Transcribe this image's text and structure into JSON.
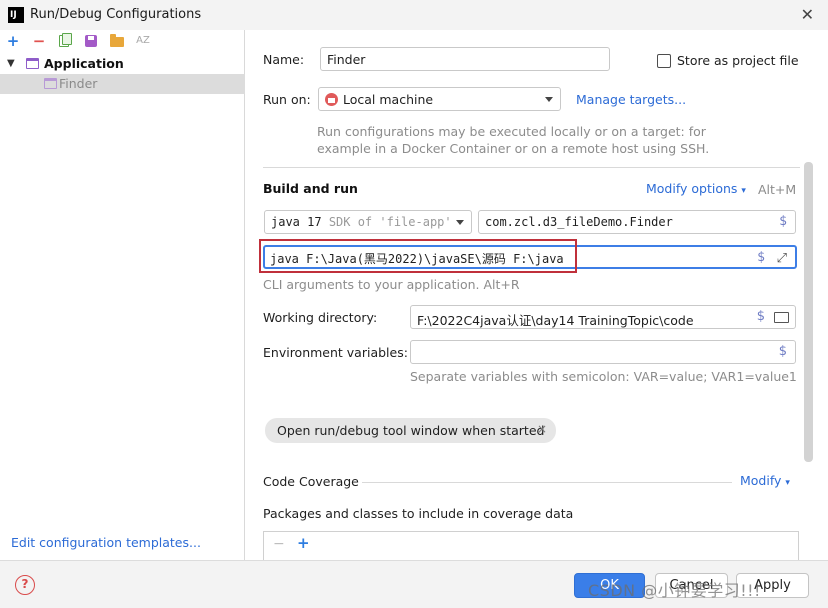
{
  "window": {
    "title": "Run/Debug Configurations",
    "logo_text": "IJ",
    "close_glyph": "✕"
  },
  "toolbar": {
    "add": "+",
    "remove": "−",
    "sort": "AZ"
  },
  "tree": {
    "group_label": "Application",
    "item_label": "Finder"
  },
  "edit_templates": "Edit configuration templates...",
  "form": {
    "name_label": "Name:",
    "name_value": "Finder",
    "store_label": "Store as project file",
    "run_on_label": "Run on:",
    "run_on_value": "Local machine",
    "manage_targets": "Manage targets...",
    "run_hint_1": "Run configurations may be executed locally or on a target: for",
    "run_hint_2": "example in a Docker Container or on a remote host using SSH.",
    "build_title": "Build and run",
    "modify_options": "Modify options",
    "modify_shortcut": "Alt+M",
    "sdk_java": "java 17",
    "sdk_detail": "SDK of 'file-app'",
    "main_class": "com.zcl.d3_fileDemo.Finder",
    "program_args": "java F:\\Java(黑马2022)\\javaSE\\源码 F:\\java",
    "args_hint": "CLI arguments to your application. Alt+R",
    "workdir_label": "Working directory:",
    "workdir_value": "F:\\2022C4java认证\\day14 TrainingTopic\\code",
    "env_label": "Environment variables:",
    "env_value": "",
    "env_hint": "Separate variables with semicolon: VAR=value; VAR1=value1",
    "chip_label": "Open run/debug tool window when started",
    "chip_close": "×",
    "coverage_title": "Code Coverage",
    "coverage_modify": "Modify",
    "coverage_packages": "Packages and classes to include in coverage data",
    "dollar": "$",
    "expand": "⤢",
    "table_minus": "−",
    "table_plus": "+"
  },
  "buttons": {
    "ok": "OK",
    "cancel": "Cancel",
    "apply": "Apply",
    "help": "?"
  },
  "watermark": "CSDN @小钟要学习!!!",
  "colors": {
    "accent": "#3a7ee8",
    "link": "#2c6bd6",
    "highlight_border": "#c0303b"
  }
}
